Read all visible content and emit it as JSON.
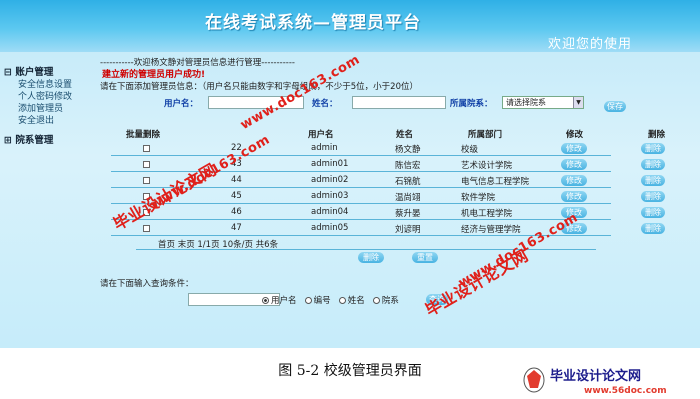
{
  "header": {
    "title": "在线考试系统—管理员平台",
    "welcome": "欢迎您的使用"
  },
  "sidebar": {
    "groups": [
      {
        "toggle": "⊟",
        "title": "账户管理",
        "items": [
          "安全信息设置",
          "个人密码修改",
          "添加管理员",
          "安全退出"
        ]
      },
      {
        "toggle": "⊞",
        "title": "院系管理"
      }
    ]
  },
  "main": {
    "intro": "-----------欢迎杨文静对管理员信息进行管理-----------",
    "success": "建立新的管理员用户成功!",
    "add_hint": "请在下面添加管理员信息：（用户名只能由数字和字母组成，不少于5位，小于20位）",
    "form": {
      "username_label": "用户名：",
      "name_label": "姓名：",
      "dept_label": "所属院系：",
      "dept_select": "请选择院系",
      "save": "保存"
    },
    "table": {
      "headers": [
        "批量删除",
        "用户名",
        "姓名",
        "所属部门",
        "修改",
        "删除"
      ],
      "rows": [
        {
          "id": "22",
          "username": "admin",
          "name": "杨文静",
          "dept": "校级",
          "edit": "修改",
          "del": "删除"
        },
        {
          "id": "43",
          "username": "admin01",
          "name": "陈信宏",
          "dept": "艺术设计学院",
          "edit": "修改",
          "del": "删除"
        },
        {
          "id": "44",
          "username": "admin02",
          "name": "石锦航",
          "dept": "电气信息工程学院",
          "edit": "修改",
          "del": "删除"
        },
        {
          "id": "45",
          "username": "admin03",
          "name": "温尚翊",
          "dept": "软件学院",
          "edit": "修改",
          "del": "删除"
        },
        {
          "id": "46",
          "username": "admin04",
          "name": "蔡升晏",
          "dept": "机电工程学院",
          "edit": "修改",
          "del": "删除"
        },
        {
          "id": "47",
          "username": "admin05",
          "name": "刘谚明",
          "dept": "经济与管理学院",
          "edit": "修改",
          "del": "删除"
        }
      ]
    },
    "pagination": "首页  末页  1/1页  10条/页  共6条",
    "batch_delete": "删除",
    "reset": "重置",
    "search_hint": "请在下面输入查询条件：",
    "search_options": [
      "用户名",
      "编号",
      "姓名",
      "院系"
    ],
    "search_button": "查询"
  },
  "watermarks": {
    "text1": "毕业设计论文网",
    "text2": "www.doc163.com"
  },
  "caption": "图 5-2  校级管理员界面",
  "logo": {
    "title": "毕业设计论文网",
    "url": "www.56doc.com"
  }
}
